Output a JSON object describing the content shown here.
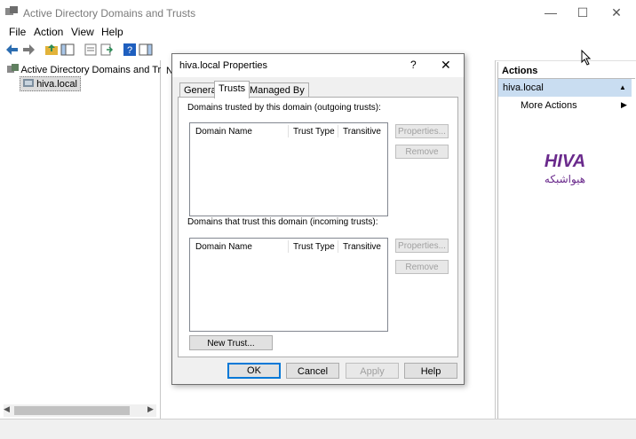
{
  "window": {
    "title": "Active Directory Domains and Trusts",
    "controls": [
      "—",
      "☐",
      "✕"
    ]
  },
  "menu": [
    "File",
    "Action",
    "View",
    "Help"
  ],
  "tree": {
    "root": "Active Directory Domains and Trusts",
    "child": "hiva.local"
  },
  "midpane": {
    "column_letter": "N"
  },
  "actions": {
    "header": "Actions",
    "selected": "hiva.local",
    "more_actions": "More Actions"
  },
  "dialog": {
    "title": "hiva.local Properties",
    "help_glyph": "?",
    "close_glyph": "✕",
    "tabs": [
      "General",
      "Trusts",
      "Managed By"
    ],
    "active_tab": "Trusts",
    "outgoing_label": "Domains trusted by this domain (outgoing trusts):",
    "incoming_label": "Domains that trust this domain (incoming trusts):",
    "columns": [
      "Domain Name",
      "Trust Type",
      "Transitive"
    ],
    "properties_label": "Properties...",
    "remove_label": "Remove",
    "new_trust_label": "New Trust...",
    "ok_label": "OK",
    "cancel_label": "Cancel",
    "apply_label": "Apply",
    "help_label": "Help"
  },
  "logo": {
    "latin": "HIVA",
    "persian": "هیواشبکه",
    "color": "#6a2a8c"
  },
  "icons": [
    "back-arrow-icon",
    "forward-arrow-icon",
    "up-folder-icon",
    "console-tree-icon",
    "properties-icon",
    "export-icon",
    "help-icon",
    "show-hide-icon"
  ],
  "colors": {
    "accent": "#0078d7",
    "selection": "#c9ddf1"
  }
}
